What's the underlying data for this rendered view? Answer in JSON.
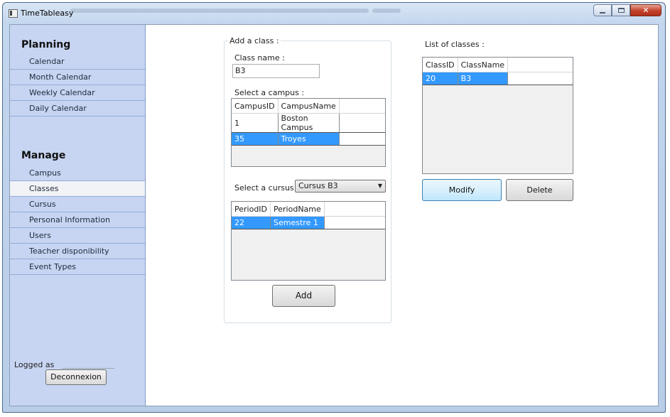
{
  "window": {
    "title": "TimeTableasy"
  },
  "sidebar": {
    "planning_title": "Planning",
    "planning_items": [
      "Calendar",
      "Month Calendar",
      "Weekly Calendar",
      "Daily Calendar"
    ],
    "manage_title": "Manage",
    "manage_items": [
      "Campus",
      "Classes",
      "Cursus",
      "Personal Information",
      "Users",
      "Teacher disponibility",
      "Event Types"
    ],
    "active_item": "Classes",
    "logged_as": "Logged as",
    "logout_label": "Deconnexion"
  },
  "add_class": {
    "group_title": "Add a class :",
    "class_name_label": "Class name :",
    "class_name_value": "B3",
    "campus_label": "Select a campus :",
    "campus_grid": {
      "columns": [
        "CampusID",
        "CampusName"
      ],
      "rows": [
        [
          "1",
          "Boston Campus"
        ],
        [
          "35",
          "Troyes"
        ]
      ],
      "selected_row": 1
    },
    "cursus_label": "Select a cursus :",
    "cursus_value": "Cursus B3",
    "period_grid": {
      "columns": [
        "PeriodID",
        "PeriodName"
      ],
      "rows": [
        [
          "22",
          "Semestre 1"
        ]
      ],
      "selected_row": 0
    },
    "add_label": "Add"
  },
  "list_classes": {
    "title": "List of classes :",
    "grid": {
      "columns": [
        "ClassID",
        "ClassName"
      ],
      "rows": [
        [
          "20",
          "B3"
        ]
      ],
      "selected_row": 0
    },
    "modify_label": "Modify",
    "delete_label": "Delete"
  },
  "icons": {
    "app": "app-window-icon",
    "minimize": "minimize-icon",
    "maximize": "maximize-icon",
    "close": "close-icon",
    "dropdown": "chevron-down-icon"
  },
  "colors": {
    "sidebar_bg": "#c7d5f2",
    "selection": "#3399ff"
  }
}
